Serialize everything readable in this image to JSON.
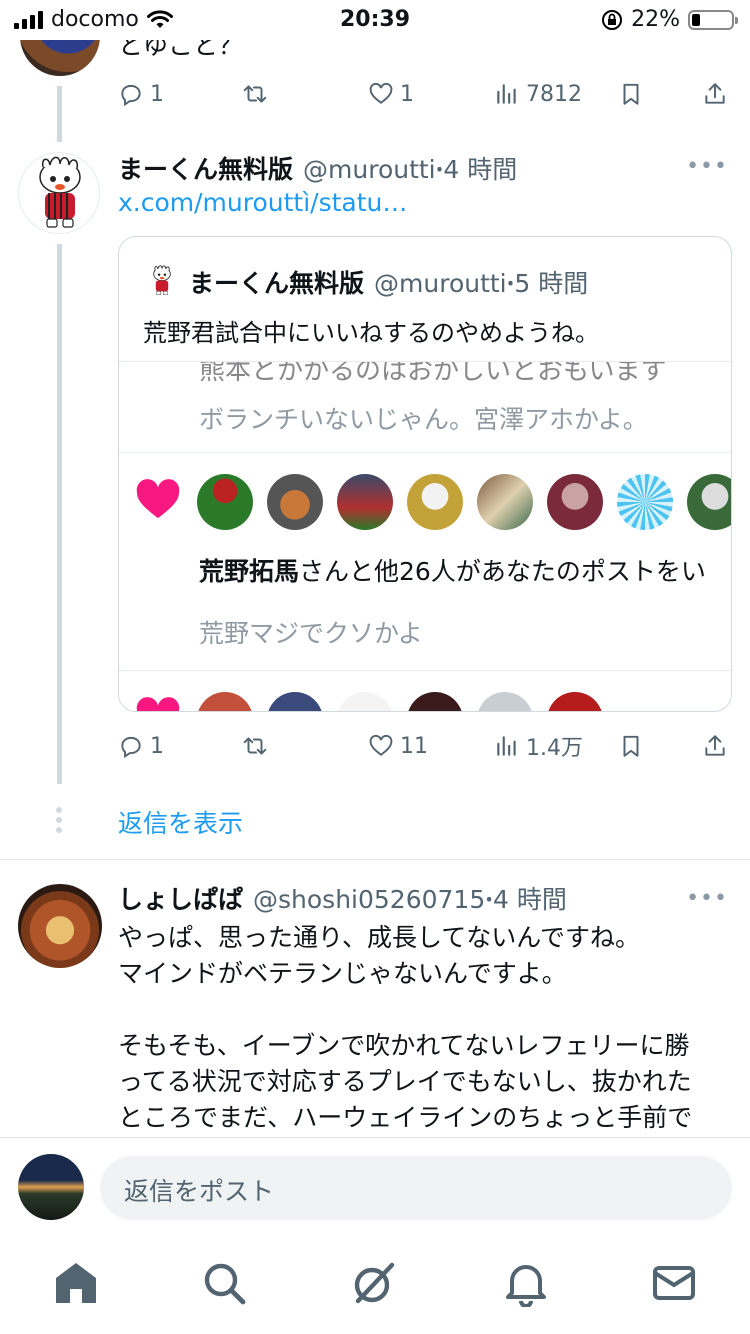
{
  "status_bar": {
    "carrier": "docomo",
    "time": "20:39",
    "battery_percent": "22%",
    "battery_level": 0.22
  },
  "top_tweet": {
    "partial_text": "とゆこと？",
    "reply_count": "1",
    "retweet_count": "",
    "like_count": "1",
    "view_count": "7812"
  },
  "tweet_main": {
    "name": "まーくん無料版",
    "handle": "@murouttiꞏ4時間",
    "handle_text": "@murouttiꞏ4 時間",
    "more": "•••",
    "link": "x.com/murouttì/statu…",
    "quote": {
      "name": "まーくん無料版",
      "handle": "@murouttiꞏ5 時間",
      "text": "荒野君試合中にいいねするのやめようね。",
      "image": {
        "cut_text": "熊本とかかるのはおかしいとおもいます",
        "line1": "ボランチいないじゃん。宮澤アホかよ。",
        "notif_bold": "荒野拓馬",
        "notif_rest": "さんと他26人があなたのポストをい",
        "line2": "荒野マジでクソかよ"
      }
    },
    "reply_count": "1",
    "retweet_count": "",
    "like_count": "11",
    "view_count": "1.4万"
  },
  "show_replies_label": "返信を表示",
  "tweet_reply": {
    "name": "しょしぱぱ",
    "handle": "@shoshi05260715ꞏ4 時間",
    "more": "•••",
    "lines": [
      "やっぱ、思った通り、成長してないんですね。",
      "マインドがベテランじゃないんですよ。",
      "",
      "そもそも、イーブンで吹かれてないレフェリーに勝",
      "ってる状況で対応するプレイでもないし、抜かれた",
      "ところでまだ、ハーウェイラインのちょっと手前で"
    ]
  },
  "reply_bar": {
    "placeholder": "返信をポスト"
  },
  "tabs": [
    "home-icon",
    "search-icon",
    "grok-icon",
    "notifications-icon",
    "messages-icon"
  ]
}
